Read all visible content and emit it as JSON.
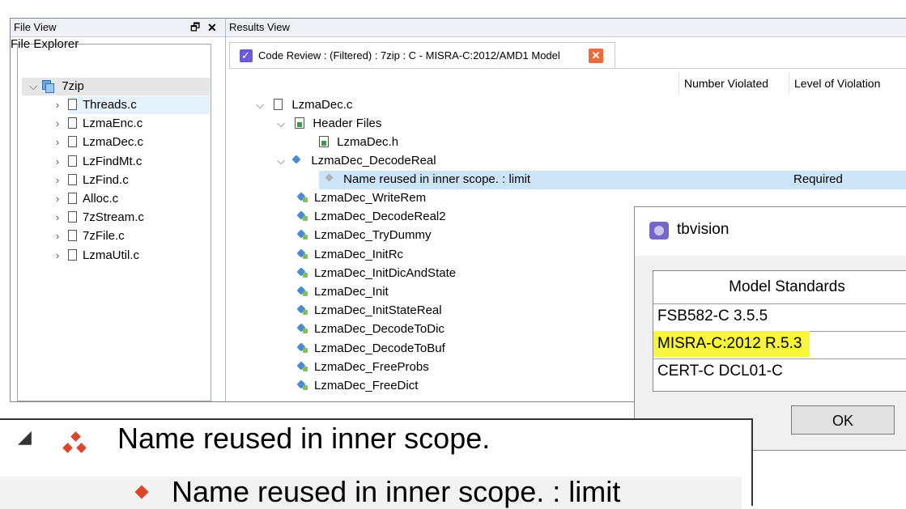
{
  "file_view": {
    "title": "File View",
    "restore_glyph": "🗗",
    "close_glyph": "✕",
    "explorer_title": "File Explorer",
    "project": "7zip",
    "files": [
      "Threads.c",
      "LzmaEnc.c",
      "LzmaDec.c",
      "LzFindMt.c",
      "LzFind.c",
      "Alloc.c",
      "7zStream.c",
      "7zFile.c",
      "LzmaUtil.c"
    ]
  },
  "results_view": {
    "title": "Results View",
    "tab_label": "Code Review : (Filtered) : 7zip : C - MISRA-C:2012/AMD1  Model",
    "tab_close": "✕",
    "columns": [
      "Number Violated",
      "Level of Violation"
    ],
    "tree": {
      "file": "LzmaDec.c",
      "header_group": "Header Files",
      "header_file": "LzmaDec.h",
      "expanded_function": "LzmaDec_DecodeReal",
      "violation": "Name reused in inner scope. : limit",
      "violation_level": "Required",
      "functions": [
        "LzmaDec_WriteRem",
        "LzmaDec_DecodeReal2",
        "LzmaDec_TryDummy",
        "LzmaDec_InitRc",
        "LzmaDec_InitDicAndState",
        "LzmaDec_Init",
        "LzmaDec_InitStateReal",
        "LzmaDec_DecodeToDic",
        "LzmaDec_DecodeToBuf",
        "LzmaDec_FreeProbs",
        "LzmaDec_FreeDict"
      ]
    }
  },
  "dialog": {
    "title": "tbvision",
    "header": "Model Standards",
    "standards": [
      "FSB582-C 3.5.5",
      "MISRA-C:2012 R.5.3",
      "CERT-C DCL01-C"
    ],
    "ok_label": "OK",
    "highlight_color": "#f7f53c"
  },
  "zoom": {
    "group_label": "Name reused in inner scope.",
    "item_label": "Name reused in inner scope. : limit"
  },
  "colors": {
    "selection": "#cce4f7",
    "tab_close": "#ea6b3d",
    "function_icon": "#4a8ad4",
    "zoom_group_icon": "#d9462b"
  }
}
